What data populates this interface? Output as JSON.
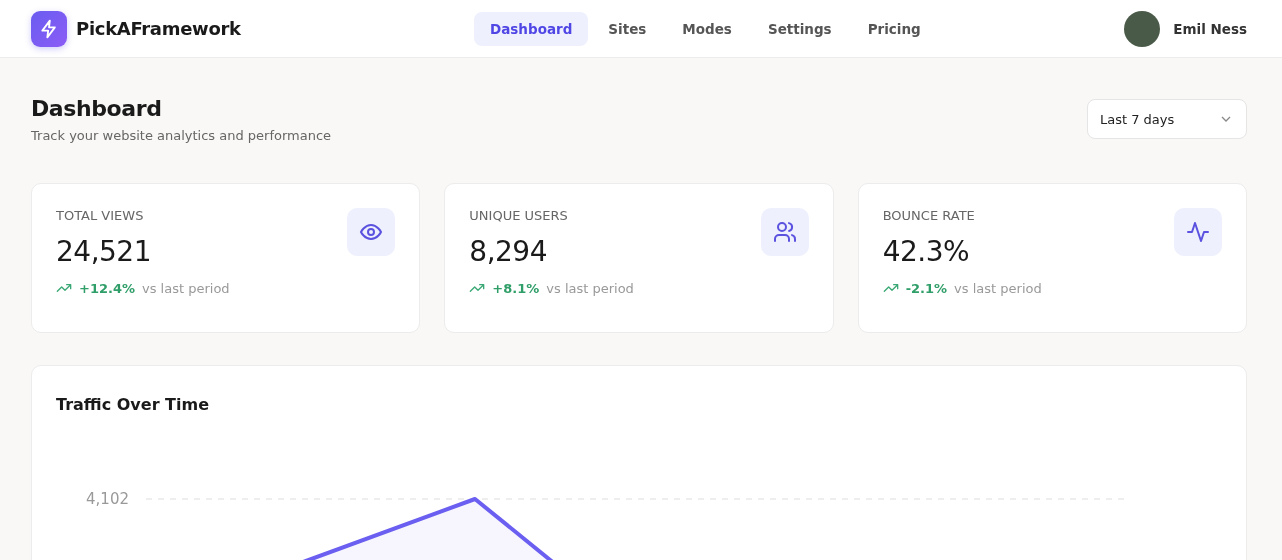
{
  "brand": {
    "name": "PickAFramework"
  },
  "nav": [
    {
      "label": "Dashboard",
      "selected": true
    },
    {
      "label": "Sites",
      "selected": false
    },
    {
      "label": "Modes",
      "selected": false
    },
    {
      "label": "Settings",
      "selected": false
    },
    {
      "label": "Pricing",
      "selected": false
    }
  ],
  "user": {
    "name": "Emil Ness"
  },
  "page": {
    "title": "Dashboard",
    "subtitle": "Track your website analytics and performance",
    "range_select": {
      "value": "Last 7 days"
    }
  },
  "stats": [
    {
      "label": "TOTAL VIEWS",
      "value": "24,521",
      "delta": "+12.4%",
      "note": "vs last period",
      "kind": "eye"
    },
    {
      "label": "UNIQUE USERS",
      "value": "8,294",
      "delta": "+8.1%",
      "note": "vs last period",
      "kind": "users"
    },
    {
      "label": "BOUNCE RATE",
      "value": "42.3%",
      "delta": "-2.1%",
      "note": "vs last period",
      "kind": "pulse"
    }
  ],
  "traffic_chart": {
    "title": "Traffic Over Time",
    "y_tick_label": "4,102"
  }
}
